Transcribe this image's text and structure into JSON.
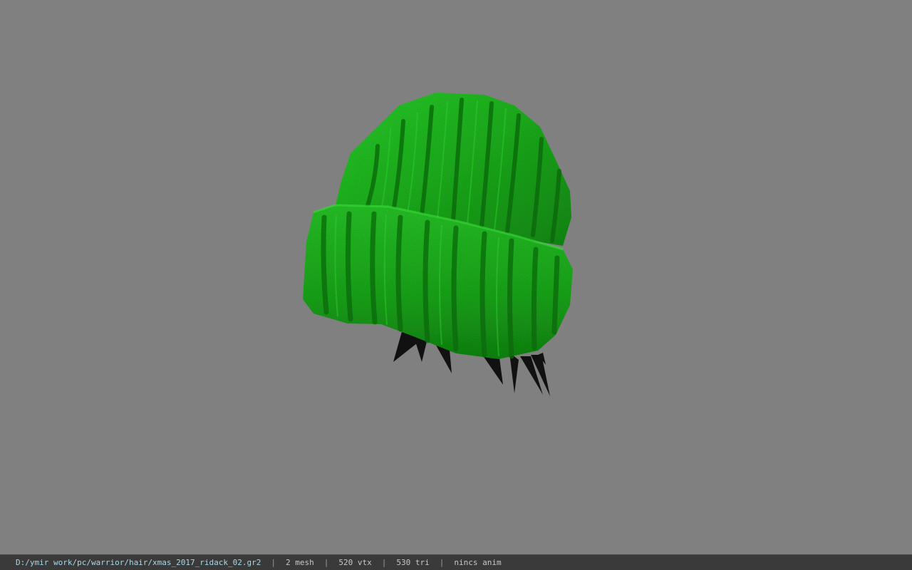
{
  "viewport": {
    "background_color": "#808080",
    "model": {
      "name": "green-knit-beanie",
      "primary_color": "#1fb51f",
      "dark_stripe_color": "#0c6e0c",
      "hair_color": "#111111"
    }
  },
  "status_bar": {
    "file_path": "D:/ymir work/pc/warrior/hair/xmas_2017_ridack_02.gr2",
    "separator": "|",
    "mesh_count": "2 mesh",
    "vertex_count": "520 vtx",
    "triangle_count": "530 tri",
    "anim_status": "nincs anim"
  }
}
